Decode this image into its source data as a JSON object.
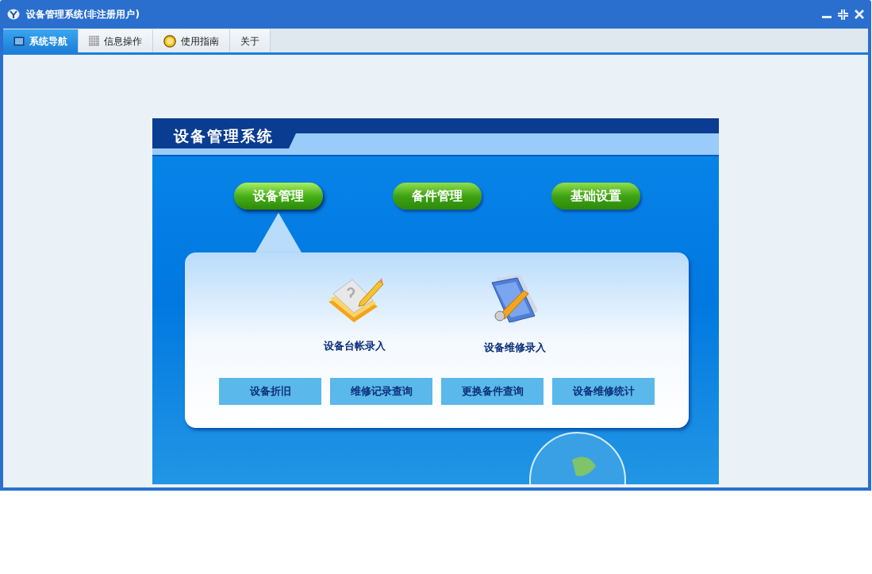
{
  "window": {
    "title": "设备管理系统(非注册用户)"
  },
  "tabs": [
    {
      "label": "系统导航",
      "kind": "monitor",
      "selected": true
    },
    {
      "label": "信息操作",
      "kind": "grid",
      "selected": false
    },
    {
      "label": "使用指南",
      "kind": "help",
      "selected": false
    },
    {
      "label": "关于",
      "kind": "plain",
      "selected": false
    }
  ],
  "banner": {
    "title": "设备管理系统",
    "menu": [
      {
        "label": "设备管理",
        "selected": true
      },
      {
        "label": "备件管理",
        "selected": false
      },
      {
        "label": "基础设置",
        "selected": false
      }
    ],
    "shortcuts": [
      {
        "label": "设备台帐录入",
        "kind": "book"
      },
      {
        "label": "设备维修录入",
        "kind": "folder"
      }
    ],
    "buttons": [
      "设备折旧",
      "维修记录查询",
      "更换备件查询",
      "设备维修统计"
    ]
  }
}
